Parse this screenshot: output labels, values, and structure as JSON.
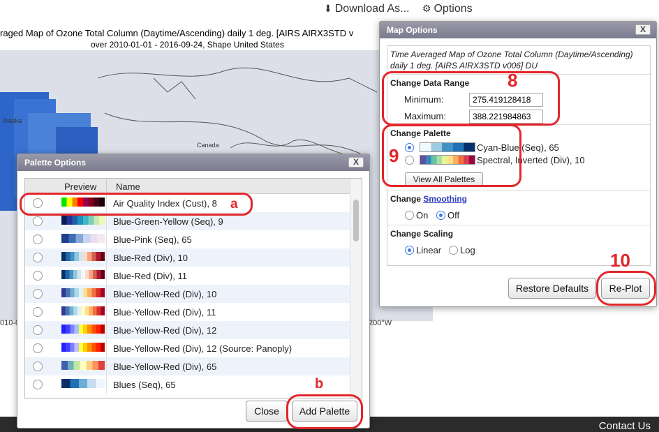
{
  "toolbar": {
    "download": "Download As...",
    "options": "Options"
  },
  "map": {
    "title": "raged Map of Ozone Total Column (Daytime/Ascending) daily 1 deg. [AIRS AIRX3STD v",
    "subtitle": "over 2010-01-01 - 2016-09-24, Shape United States",
    "label_alaska": "Alaska",
    "label_canada": "Canada",
    "bottom_left": "010-0",
    "bottom_right": "200°W"
  },
  "footer": {
    "contact": "Contact Us"
  },
  "palette_dialog": {
    "title": "Palette Options",
    "close_x": "X",
    "col_preview": "Preview",
    "col_name": "Name",
    "rows": [
      {
        "name": "Air Quality Index (Cust), 8",
        "colors": [
          "#00e400",
          "#ffff00",
          "#ff7e00",
          "#ff0000",
          "#99004c",
          "#7e0023",
          "#4c0013",
          "#1a0008"
        ]
      },
      {
        "name": "Blue-Green-Yellow (Seq), 9",
        "colors": [
          "#081d58",
          "#253494",
          "#225ea8",
          "#1d91c0",
          "#41b6c4",
          "#7fcdbb",
          "#c7e9b4",
          "#edf8b1"
        ]
      },
      {
        "name": "Blue-Pink (Seq), 65",
        "colors": [
          "#1f3f8c",
          "#3f6eb4",
          "#86a8d8",
          "#c9d4ee",
          "#e9dff0",
          "#f6e8f0"
        ]
      },
      {
        "name": "Blue-Red (Div), 10",
        "colors": [
          "#053061",
          "#2166ac",
          "#4393c3",
          "#92c5de",
          "#d1e5f0",
          "#fddbc7",
          "#f4a582",
          "#d6604d",
          "#b2182b",
          "#67001f"
        ]
      },
      {
        "name": "Blue-Red (Div), 11",
        "colors": [
          "#053061",
          "#2166ac",
          "#4393c3",
          "#92c5de",
          "#d1e5f0",
          "#f7f7f7",
          "#fddbc7",
          "#f4a582",
          "#d6604d",
          "#b2182b",
          "#67001f"
        ]
      },
      {
        "name": "Blue-Yellow-Red (Div), 10",
        "colors": [
          "#313695",
          "#4575b4",
          "#74add1",
          "#abd9e9",
          "#e0f3f8",
          "#fee090",
          "#fdae61",
          "#f46d43",
          "#d73027",
          "#a50026"
        ]
      },
      {
        "name": "Blue-Yellow-Red (Div), 11",
        "colors": [
          "#313695",
          "#4575b4",
          "#74add1",
          "#abd9e9",
          "#e0f3f8",
          "#ffffbf",
          "#fee090",
          "#fdae61",
          "#f46d43",
          "#d73027",
          "#a50026"
        ]
      },
      {
        "name": "Blue-Yellow-Red (Div), 12",
        "colors": [
          "#2020ff",
          "#4040ff",
          "#8080ff",
          "#a0c0ff",
          "#ffff40",
          "#ffd000",
          "#ff9000",
          "#ff5000",
          "#ff2000",
          "#c00000"
        ]
      },
      {
        "name": "Blue-Yellow-Red (Div), 12 (Source: Panoply)",
        "colors": [
          "#2020ff",
          "#4040ff",
          "#8080ff",
          "#c0c0ff",
          "#ffff40",
          "#ffd000",
          "#ff9000",
          "#ff5000",
          "#ff2000",
          "#c00000"
        ]
      },
      {
        "name": "Blue-Yellow-Red (Div), 65",
        "colors": [
          "#4060b0",
          "#70b0c0",
          "#c0e8a0",
          "#ffffc0",
          "#ffd080",
          "#ff9060",
          "#e04040"
        ]
      },
      {
        "name": "Blues (Seq), 65",
        "colors": [
          "#08306b",
          "#2171b5",
          "#6baed6",
          "#c6dbef",
          "#f0f6ff"
        ]
      }
    ],
    "close_button": "Close",
    "add_button": "Add Palette"
  },
  "map_dialog": {
    "title": "Map Options",
    "close_x": "X",
    "description": "Time Averaged Map of Ozone Total Column (Daytime/Ascending) daily 1 deg. [AIRS AIRX3STD v006] DU",
    "data_range": {
      "title": "Change Data Range",
      "min_label": "Minimum:",
      "min_value": "275.419128418",
      "max_label": "Maximum:",
      "max_value": "388.221984863"
    },
    "palette": {
      "title": "Change Palette",
      "opt1": "Cyan-Blue (Seq), 65",
      "opt2": "Spectral, Inverted (Div), 10",
      "opt1_colors": [
        "#f0f9ff",
        "#9ecae1",
        "#4292c6",
        "#2171b5",
        "#08306b"
      ],
      "opt2_colors": [
        "#5e4fa2",
        "#3288bd",
        "#66c2a5",
        "#abdda4",
        "#e6f598",
        "#fee08b",
        "#fdae61",
        "#f46d43",
        "#d53e4f",
        "#9e0142"
      ],
      "view_all": "View All Palettes"
    },
    "smoothing": {
      "prefix": "Change ",
      "link": "Smoothing",
      "on": "On",
      "off": "Off"
    },
    "scaling": {
      "title": "Change Scaling",
      "linear": "Linear",
      "log": "Log"
    },
    "restore_button": "Restore Defaults",
    "replot_button": "Re-Plot"
  },
  "annotations": {
    "a": "a",
    "b": "b",
    "n8": "8",
    "n9": "9",
    "n10": "10"
  }
}
